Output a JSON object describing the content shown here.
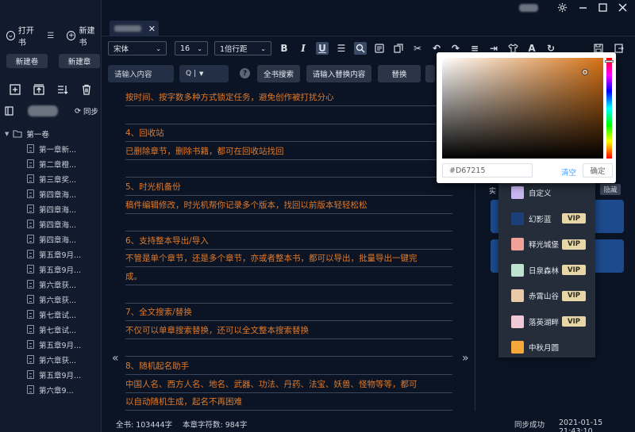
{
  "sidebar": {
    "open_book": "打开书",
    "new_book": "新建书",
    "new_volume": "新建卷",
    "new_chapter": "新建章",
    "sync": "同步",
    "volume": "第一卷",
    "chapters": [
      "第一章新...",
      "第二章橙...",
      "第三章奖...",
      "第四章海...",
      "第四章海...",
      "第四章海...",
      "第四章海...",
      "第五章9月...",
      "第五章9月...",
      "第六章获...",
      "第六章获...",
      "第七章试...",
      "第七章试...",
      "第五章9月...",
      "第六章获...",
      "第五章9月...",
      "第六章9..."
    ]
  },
  "toolbar": {
    "font": "宋体",
    "size": "16",
    "line_spacing": "1倍行距"
  },
  "search": {
    "placeholder": "请输入内容",
    "mode": "Q |",
    "help": "?",
    "full_search": "全书搜索",
    "replace_placeholder": "请输入替换内容",
    "replace": "替换"
  },
  "editor": {
    "lines": [
      "按时间、按字数多种方式锁定任务，避免创作被打扰分心",
      "",
      "4、回收站",
      "已删除章节，删除书籍，都可在回收站找回",
      "",
      "5、时光机备份",
      "稿件编辑修改，时光机帮你记录多个版本，找回以前版本轻轻松松",
      "",
      "6、支持整本导出/导入",
      "不管是单个章节，还是多个章节，亦或者整本书，都可以导出，批量导出一键完",
      "成。",
      "",
      "7、全文搜索/替换",
      "不仅可以单章搜索替换，还可以全文整本搜索替换",
      "",
      "8、随机起名助手",
      "中国人名、西方人名、地名、武器、功法、丹药、法宝、妖兽、怪物等等，都可",
      "以自动随机生成，起名不再困难"
    ],
    "prev": "«",
    "next": "»"
  },
  "right_panel": {
    "label": "实",
    "hide": "隐藏"
  },
  "theme_menu": {
    "items": [
      {
        "name": "自定义",
        "vip": "",
        "color": "#c8b6f0"
      },
      {
        "name": "幻影蓝",
        "vip": "VIP",
        "color": "#1c3f7a"
      },
      {
        "name": "释光城堡",
        "vip": "VIP",
        "color": "#f2a19a"
      },
      {
        "name": "日泉森林",
        "vip": "VIP",
        "color": "#bfe3d2"
      },
      {
        "name": "赤霄山谷",
        "vip": "VIP",
        "color": "#e8c9a8"
      },
      {
        "name": "落英湖畔",
        "vip": "VIP",
        "color": "#f0c8d6"
      },
      {
        "name": "中秋月圆",
        "vip": "",
        "color": "#f4a93a"
      }
    ]
  },
  "color_picker": {
    "hex": "#D67215",
    "clear": "清空",
    "confirm": "确定",
    "accent": "#d67215"
  },
  "status": {
    "book_words": "全书: 103444字",
    "chapter_words": "本章字符数: 984字",
    "sync_status": "同步成功",
    "datetime": "2021-01-15 21:43:10"
  }
}
